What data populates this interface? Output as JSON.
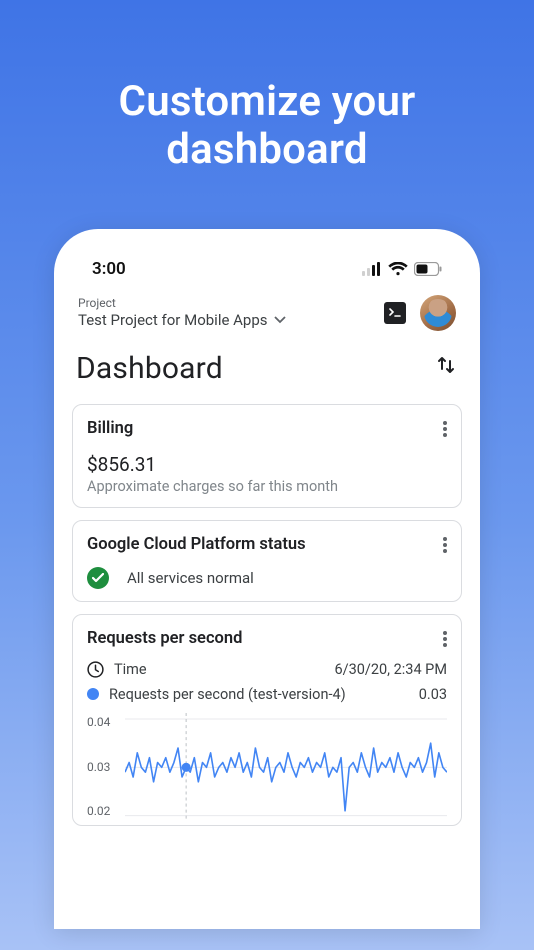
{
  "hero": {
    "line1": "Customize your",
    "line2": "dashboard"
  },
  "status_bar": {
    "time": "3:00"
  },
  "project": {
    "label": "Project",
    "name": "Test Project for Mobile Apps"
  },
  "dashboard": {
    "title": "Dashboard"
  },
  "billing": {
    "title": "Billing",
    "amount": "$856.31",
    "caption": "Approximate charges so far this month"
  },
  "gcp_status": {
    "title": "Google Cloud Platform status",
    "message": "All services normal"
  },
  "rps": {
    "title": "Requests per second",
    "time_label": "Time",
    "time_value": "6/30/20, 2:34 PM",
    "series_label": "Requests per second (test-version-4)",
    "series_value": "0.03"
  },
  "chart_data": {
    "type": "line",
    "title": "Requests per second",
    "ylabel": "",
    "xlabel": "",
    "ylim": [
      0.02,
      0.04
    ],
    "yticks": [
      0.02,
      0.03,
      0.04
    ],
    "highlight_index": 15,
    "series": [
      {
        "name": "Requests per second (test-version-4)",
        "values": [
          0.029,
          0.031,
          0.028,
          0.033,
          0.03,
          0.029,
          0.032,
          0.027,
          0.031,
          0.03,
          0.032,
          0.029,
          0.031,
          0.034,
          0.028,
          0.03,
          0.029,
          0.032,
          0.027,
          0.031,
          0.03,
          0.033,
          0.028,
          0.03,
          0.031,
          0.029,
          0.032,
          0.03,
          0.033,
          0.029,
          0.031,
          0.028,
          0.034,
          0.03,
          0.029,
          0.032,
          0.027,
          0.03,
          0.031,
          0.029,
          0.033,
          0.03,
          0.028,
          0.031,
          0.03,
          0.032,
          0.029,
          0.031,
          0.03,
          0.033,
          0.028,
          0.03,
          0.029,
          0.032,
          0.021,
          0.03,
          0.031,
          0.029,
          0.033,
          0.03,
          0.028,
          0.034,
          0.029,
          0.031,
          0.03,
          0.032,
          0.029,
          0.033,
          0.03,
          0.028,
          0.031,
          0.03,
          0.032,
          0.029,
          0.031,
          0.035,
          0.028,
          0.033,
          0.03,
          0.029
        ]
      }
    ]
  }
}
